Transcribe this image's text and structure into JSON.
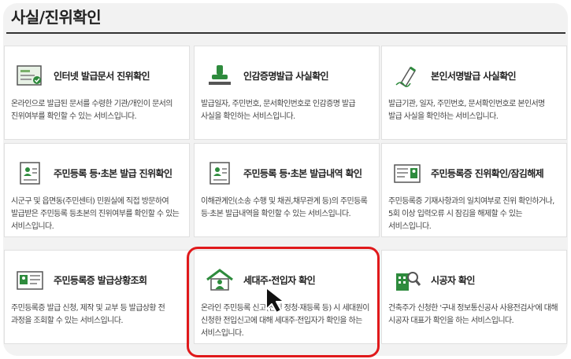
{
  "page": {
    "title": "사실/진위확인"
  },
  "cards": [
    {
      "title": "인터넷 발급문서 진위확인",
      "icon": "certificate-check-icon",
      "desc": "온라인으로 발급된 문서를 수령한 기관/개인이 문서의 진위여부를 확인할 수 있는 서비스입니다."
    },
    {
      "title": "인감증명발급 사실확인",
      "icon": "seal-stamp-icon",
      "desc": "발급일자, 주민번호, 문서확인번호로 인감증명 발급 사실을 확인하는 서비스입니다."
    },
    {
      "title": "본인서명발급 사실확인",
      "icon": "signature-pen-icon",
      "desc": "발급기관, 일자, 주민번호, 문서확인번호로 본인서명 발급 사실을 확인하는 서비스입니다."
    },
    {
      "title": "주민등록 등·초본 발급 진위확인",
      "icon": "resident-document-icon",
      "desc": "시군구 및 읍면동(주민센터) 민원실에 직접 방문하여 발급받은 주민등록 등초본의 진위여부를 확인할 수 있는 서비스입니다."
    },
    {
      "title": "주민등록 등·초본 발급내역 확인",
      "icon": "resident-document-icon",
      "desc": "이해관계인(소송 수행 및 채권,채무관계 등)의 주민등록 등·초본 발급내역을 확인할 수 있는 서비스입니다."
    },
    {
      "title": "주민등록증 진위확인/잠김해제",
      "icon": "id-card-icon",
      "desc": "주민등록증 기재사항과의 일치여부로 진위 확인하거나, 5회 이상 입력오류 시 잠김을 해제할 수 있는 서비스입니다."
    },
    {
      "title": "주민등록증 발급상황조회",
      "icon": "id-card-search-icon",
      "desc": "주민등록증 발급 신청, 제작 및 교부 등 발급상황 전 과정을 조회할 수 있는 서비스입니다."
    },
    {
      "title": "세대주·전입자 확인",
      "icon": "house-person-icon",
      "desc": "온라인 주민등록 신고(전입 정청·재등록 등) 시 세대원이 신청한 전입신고에 대해 세대주·전입자가 확인을 하는 서비스입니다."
    },
    {
      "title": "시공자 확인",
      "icon": "building-search-icon",
      "desc": "건축주가 신청한 '구내 정보통신공사 사용전검사'에 대해 시공자 대표가 확인을 하는 서비스입니다."
    }
  ],
  "colors": {
    "accent_green": "#2e8b3d",
    "highlight_red": "#e0191b"
  }
}
